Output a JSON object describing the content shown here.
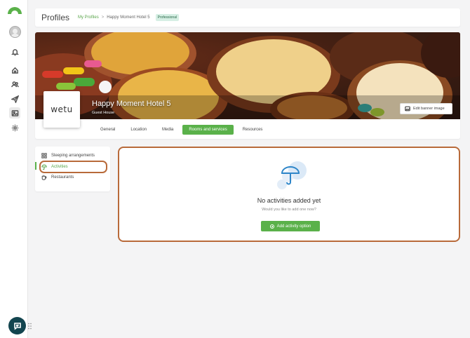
{
  "header": {
    "title": "Profiles",
    "breadcrumb_root": "My Profiles",
    "breadcrumb_separator": ">",
    "breadcrumb_current": "Happy Moment Hotel 5",
    "badge": "Professional"
  },
  "profile": {
    "logo_text": "wetu",
    "name": "Happy Moment Hotel 5",
    "type": "Guest House",
    "edit_banner_label": "Edit banner image"
  },
  "tabs": [
    {
      "label": "General"
    },
    {
      "label": "Location"
    },
    {
      "label": "Media"
    },
    {
      "label": "Rooms and services",
      "active": true
    },
    {
      "label": "Resources"
    }
  ],
  "side_menu": [
    {
      "label": "Sleeping arrangements",
      "icon": "grid-icon"
    },
    {
      "label": "Activities",
      "icon": "umbrella-icon",
      "active": true
    },
    {
      "label": "Restaurants",
      "icon": "cup-icon"
    }
  ],
  "empty_state": {
    "title": "No activities added yet",
    "subtitle": "Would you like to add one now?",
    "button_label": "Add activity option"
  },
  "colors": {
    "accent_green": "#5ab14a",
    "highlight_orange": "#b86a3a",
    "chat_button": "#13454f",
    "illustration_blue": "#2e86c9"
  }
}
